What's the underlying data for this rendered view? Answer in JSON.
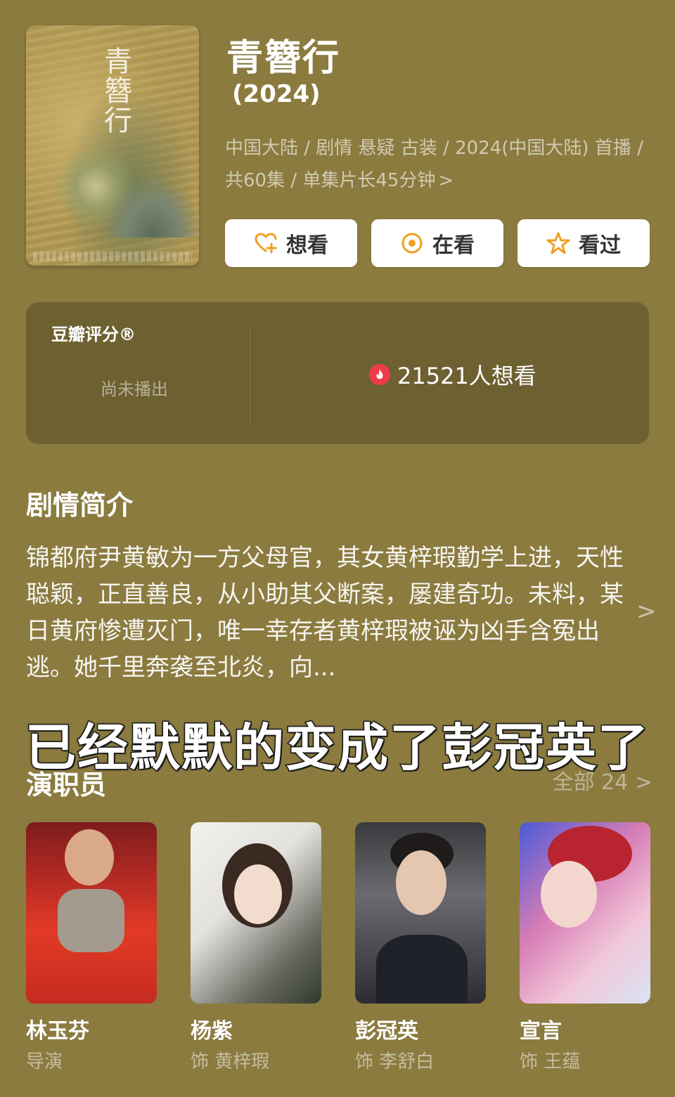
{
  "movie": {
    "poster_title": "青簪行",
    "title": "青簪行",
    "year": "(2024)",
    "meta": "中国大陆 / 剧情 悬疑 古装 / 2024(中国大陆) 首播 / 共60集 / 单集片长45分钟",
    "meta_chevron": ">"
  },
  "actions": {
    "want": "想看",
    "watching": "在看",
    "watched": "看过"
  },
  "rating": {
    "label": "豆瓣评分®",
    "status": "尚未播出",
    "want_count": "21521人想看"
  },
  "synopsis": {
    "title": "剧情简介",
    "text": "锦都府尹黄敏为一方父母官，其女黄梓瑕勤学上进，天性聪颖，正直善良，从小助其父断案，屡建奇功。未料，某日黄府惨遭灭门，唯一幸存者黄梓瑕被诬为凶手含冤出逃。她千里奔袭至北炎，向...",
    "chevron": ">"
  },
  "caption": "已经默默的变成了彭冠英了",
  "cast": {
    "title": "演职员",
    "all_label": "全部 24 >",
    "members": [
      {
        "name": "林玉芬",
        "role": "导演"
      },
      {
        "name": "杨紫",
        "role": "饰 黄梓瑕"
      },
      {
        "name": "彭冠英",
        "role": "饰 李舒白"
      },
      {
        "name": "宣言",
        "role": "饰 王蕴"
      }
    ]
  },
  "colors": {
    "background": "#8b7b3f",
    "rating_card": "#6e6131",
    "accent_orange": "#f0a020",
    "fire_red": "#ee3b4b"
  }
}
